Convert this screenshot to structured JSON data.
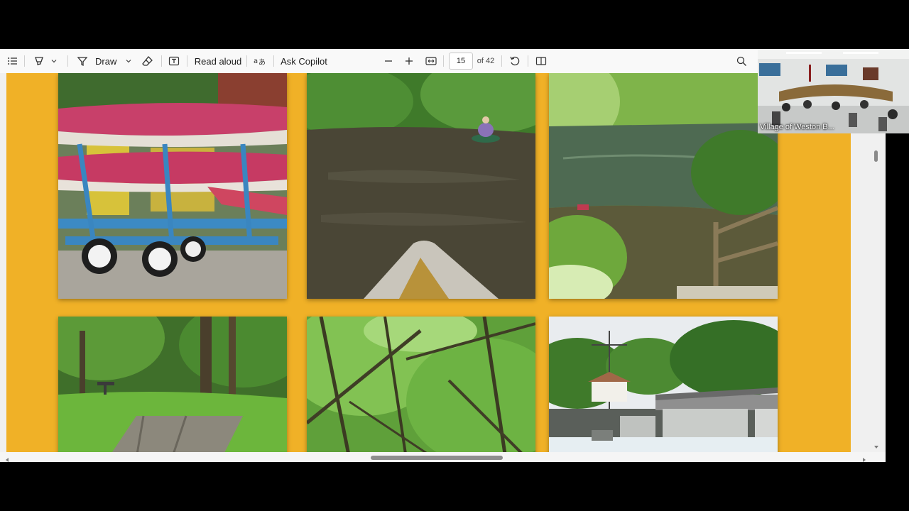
{
  "toolbar": {
    "draw_label": "Draw",
    "read_aloud_label": "Read aloud",
    "ask_copilot_label": "Ask Copilot",
    "page_number": "15",
    "page_total": "of 42"
  },
  "video": {
    "participant_label": "Village of Weston B..."
  },
  "colors": {
    "page_background": "#f0b127",
    "toolbar_background": "#f9f9f9"
  },
  "photos": [
    {
      "subject": "canoes on trailer"
    },
    {
      "subject": "kayaker on river"
    },
    {
      "subject": "river bank with fence"
    },
    {
      "subject": "picnic table in woods"
    },
    {
      "subject": "forest canopy"
    },
    {
      "subject": "dam and bridge"
    }
  ]
}
